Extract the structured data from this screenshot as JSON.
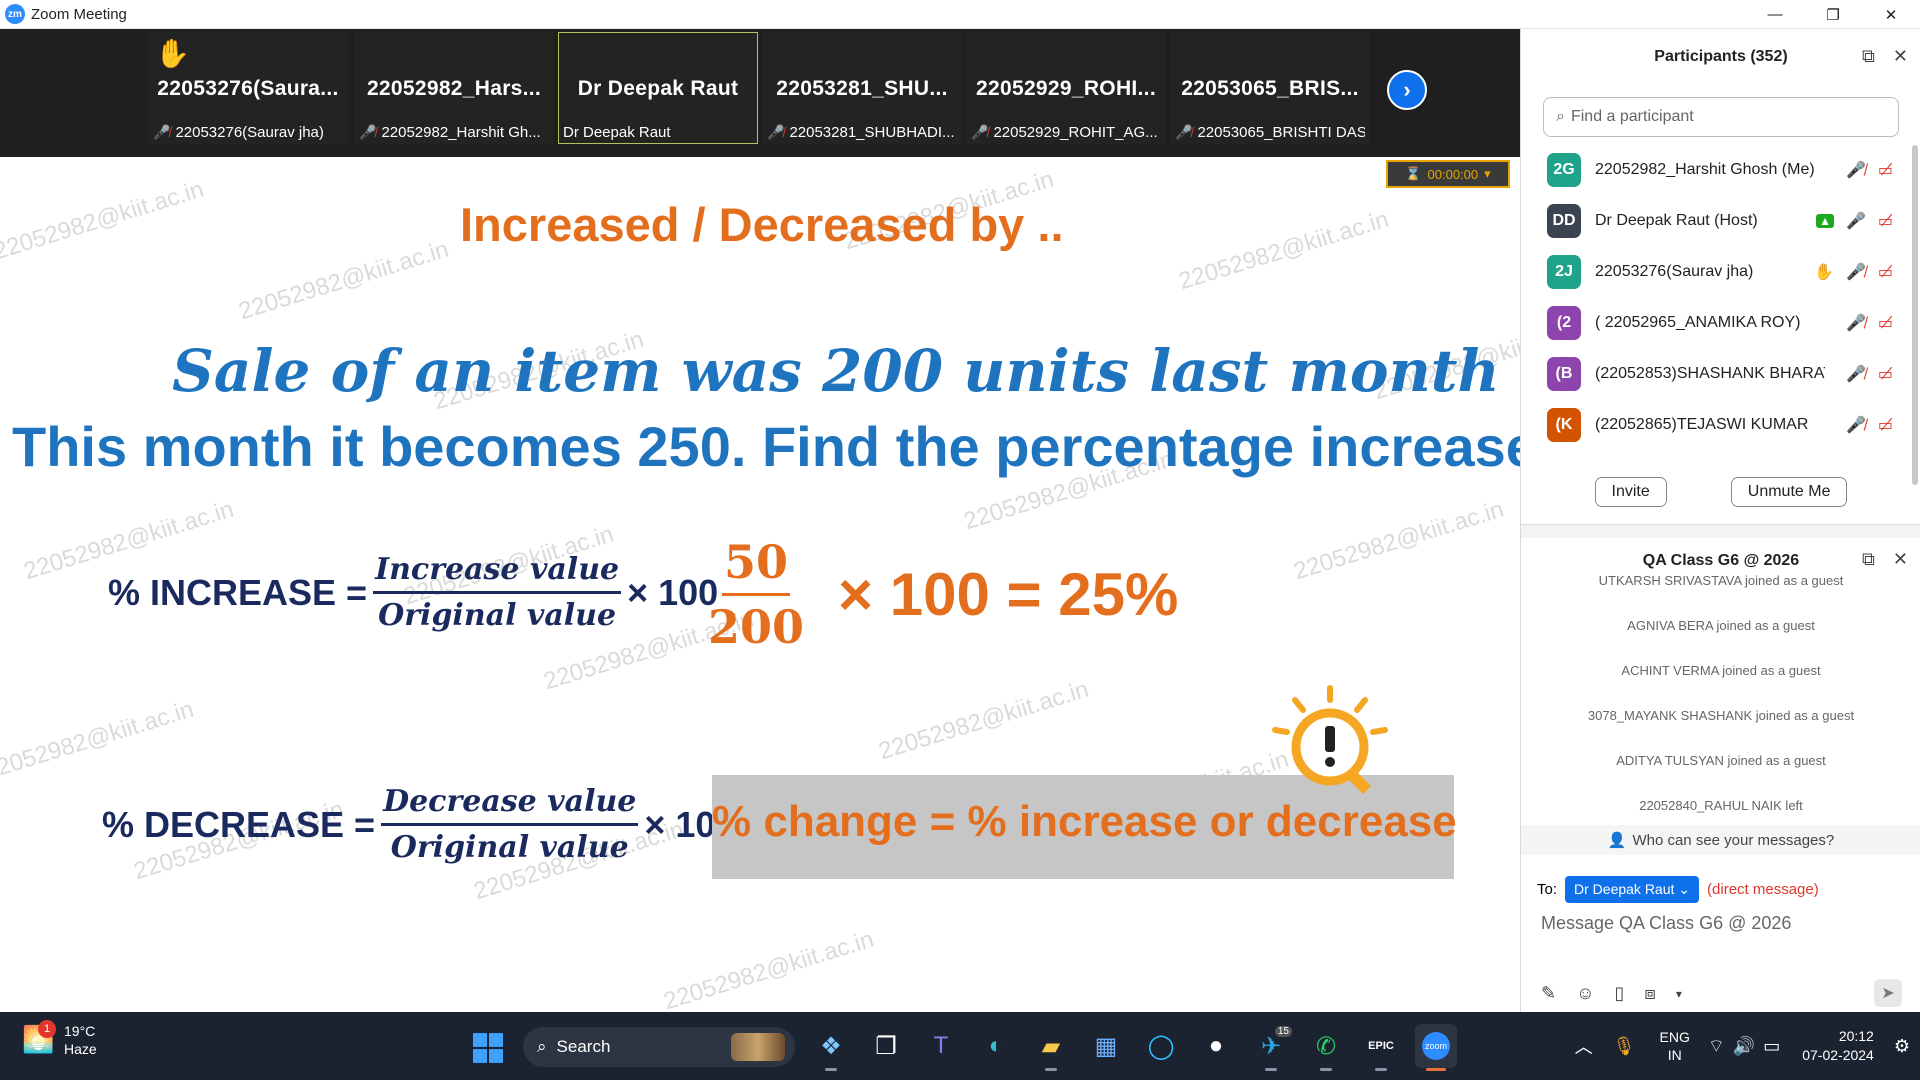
{
  "app": {
    "title": "Zoom Meeting",
    "logo": "zm"
  },
  "window_controls": {
    "minimize": "—",
    "restore": "❐",
    "close": "✕"
  },
  "video_strip": {
    "tiles": [
      {
        "name": "22053276(Saura...",
        "label": "22053276(Saurav jha)",
        "hand": "✋"
      },
      {
        "name": "22052982_Hars...",
        "label": "22052982_Harshit Gh..."
      },
      {
        "name": "Dr Deepak Raut",
        "label": "Dr Deepak Raut"
      },
      {
        "name": "22053281_SHU...",
        "label": "22053281_SHUBHADI..."
      },
      {
        "name": "22052929_ROHI...",
        "label": "22052929_ROHIT_AG..."
      },
      {
        "name": "22053065_BRIS...",
        "label": "22053065_BRISHTI DAS"
      }
    ],
    "next_arrow": "›"
  },
  "watermark": "22052982@kiit.ac.in",
  "timer": {
    "icon": "⌛",
    "value": "00:00:00",
    "caret": "▾"
  },
  "slide": {
    "title": "Increased / Decreased by ..",
    "question_line1": "Sale of an item was 200 units  last month",
    "question_line2": "This month it becomes 250. Find the percentage increase.",
    "increase_formula": {
      "label": "% INCREASE =",
      "numerator": "Increase value",
      "denominator": "Original value",
      "tail": "× 100"
    },
    "decrease_formula": {
      "label": "% DECREASE =",
      "numerator": "Decrease value",
      "denominator": "Original value",
      "tail": "× 100"
    },
    "calc": {
      "numerator": "50",
      "denominator": "200",
      "result": "×  100 = 25%"
    },
    "change_note": "% change = % increase or decrease"
  },
  "participants": {
    "title": "Participants (352)",
    "search_placeholder": "Find a participant",
    "list": [
      {
        "initials": "2G",
        "color": "#1fa38a",
        "name": "22052982_Harshit Ghosh (Me)"
      },
      {
        "initials": "DD",
        "color": "#3b4350",
        "name": "Dr Deepak Raut (Host)"
      },
      {
        "initials": "2J",
        "color": "#1fa38a",
        "name": "22053276(Saurav jha)"
      },
      {
        "initials": "(2",
        "color": "#8e44ad",
        "name": "( 22052965_ANAMIKA ROY)"
      },
      {
        "initials": "(B",
        "color": "#8e44ad",
        "name": "(22052853)SHASHANK BHARAT..."
      },
      {
        "initials": "(K",
        "color": "#d35400",
        "name": "(22052865)TEJASWI KUMAR"
      }
    ],
    "invite_label": "Invite",
    "unmute_label": "Unmute Me"
  },
  "chat": {
    "title": "QA Class G6 @ 2026",
    "messages": [
      "UTKARSH SRIVASTAVA joined as a guest",
      "AGNIVA BERA joined as a guest",
      "ACHINT VERMA joined as a guest",
      "3078_MAYANK SHASHANK joined as a guest",
      "ADITYA TULSYAN joined as a guest",
      "22052840_RAHUL NAIK left"
    ],
    "who_can_see": "Who can see your messages?",
    "to_label": "To:",
    "to_recipient": "Dr Deepak Raut",
    "direct_message": "(direct message)",
    "input_placeholder": "Message QA Class G6 @ 2026"
  },
  "taskbar": {
    "weather_temp": "19°C",
    "weather_desc": "Haze",
    "weather_badge": "1",
    "search_label": "Search",
    "telegram_badge": "15",
    "lang_line1": "ENG",
    "lang_line2": "IN",
    "time": "20:12",
    "date": "07-02-2024"
  }
}
